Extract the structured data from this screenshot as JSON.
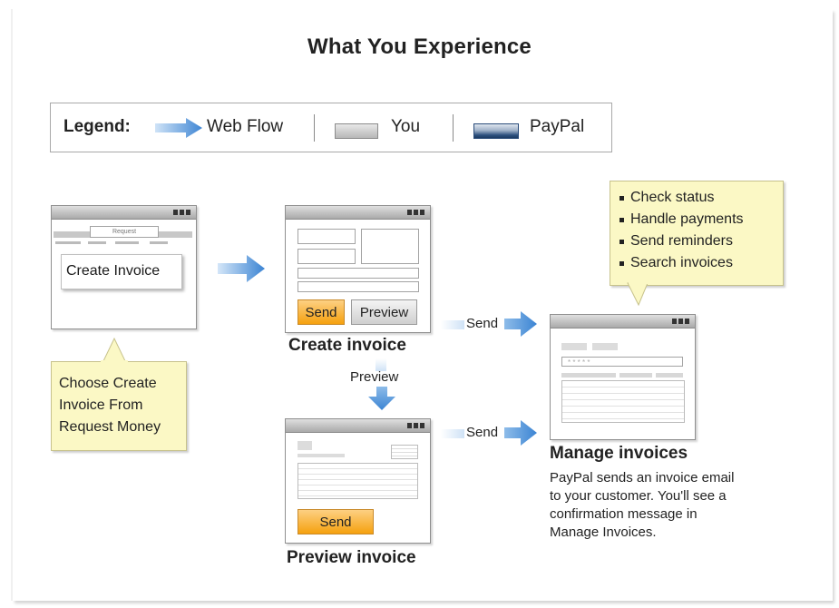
{
  "title": "What You Experience",
  "legend": {
    "label": "Legend:",
    "items": [
      {
        "label": "Web Flow",
        "icon": "blue-arrow-icon"
      },
      {
        "label": "You",
        "icon": "gray-swatch-icon"
      },
      {
        "label": "PayPal",
        "icon": "blue-swatch-icon"
      }
    ]
  },
  "colors": {
    "arrow": "#4a90d9",
    "button_orange": "#f5a10f",
    "note_yellow": "#fbf8c5"
  },
  "step1": {
    "tab_label": "Request",
    "callout": "Create Invoice",
    "note_lines": [
      "Choose Create",
      "Invoice From",
      "Request Money"
    ]
  },
  "step2": {
    "send_button": "Send",
    "preview_button": "Preview",
    "caption": "Create invoice"
  },
  "step3": {
    "send_button": "Send",
    "caption": "Preview invoice"
  },
  "step4": {
    "caption": "Manage invoices",
    "description_lines": [
      "PayPal sends an invoice email",
      "to your customer. You'll see a",
      "confirmation message in",
      "Manage Invoices."
    ],
    "search_field": "* * * * *",
    "tips": [
      "Check status",
      "Handle payments",
      "Send reminders",
      "Search invoices"
    ]
  },
  "flow_labels": {
    "send_top": "Send",
    "preview": "Preview",
    "send_bottom": "Send"
  }
}
